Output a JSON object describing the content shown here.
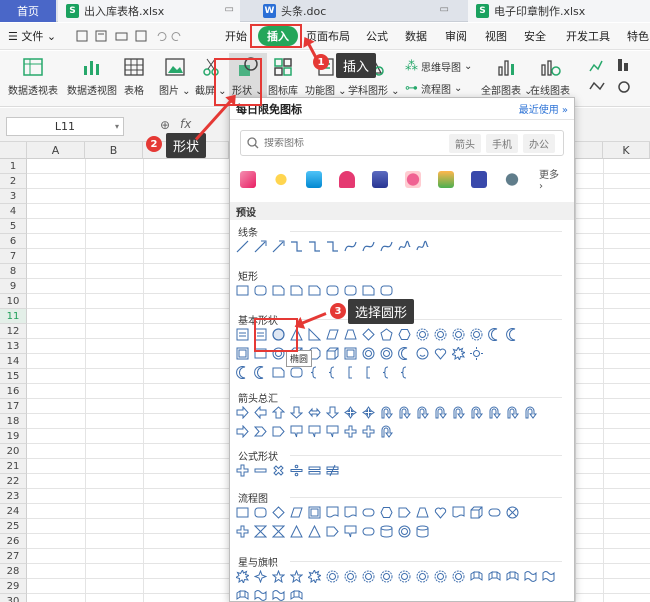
{
  "tabs": [
    {
      "label": "首页"
    },
    {
      "label": "出入库表格.xlsx",
      "kind": "S"
    },
    {
      "label": "头条.doc",
      "kind": "W"
    },
    {
      "label": "电子印章制作.xlsx",
      "kind": "S"
    }
  ],
  "menu": {
    "file": "文件",
    "items": [
      "开始",
      "插入",
      "页面布局",
      "公式",
      "数据",
      "审阅",
      "视图",
      "安全",
      "开发工具",
      "特色"
    ],
    "active": "插入"
  },
  "ribbon": {
    "buttons": [
      "数据透视表",
      "数据透视图",
      "表格",
      "图片",
      "截屏",
      "形状",
      "图标库",
      "功能图",
      "学科图形",
      "全部图表",
      "在线图表"
    ],
    "small": [
      "思维导图",
      "流程图"
    ],
    "shape_highlight": "形状"
  },
  "formula": {
    "cell_ref": "L11"
  },
  "grid": {
    "columns": [
      "A",
      "B",
      "K"
    ],
    "rows": [
      "1",
      "2",
      "3",
      "4",
      "5",
      "6",
      "7",
      "8",
      "9",
      "10",
      "11",
      "12",
      "13",
      "14",
      "15",
      "16",
      "17",
      "18",
      "19",
      "20",
      "21",
      "22",
      "23",
      "24",
      "25",
      "26",
      "27",
      "28",
      "29",
      "30"
    ],
    "selected_row": "11"
  },
  "panel": {
    "title": "每日限免图标",
    "recent": "最近使用",
    "search_placeholder": "搜索图标",
    "chips": [
      "箭头",
      "手机",
      "办公"
    ],
    "more": "更多",
    "preset": "预设",
    "sections": [
      "线条",
      "矩形",
      "基本形状",
      "箭头总汇",
      "公式形状",
      "流程图",
      "星与旗帜"
    ],
    "tooltip": "椭圆"
  },
  "callouts": [
    {
      "num": "1",
      "text": "插入"
    },
    {
      "num": "2",
      "text": "形状"
    },
    {
      "num": "3",
      "text": "选择圆形"
    }
  ],
  "colors": {
    "accent": "#24a65a",
    "callout": "#e53935",
    "icon_line": "#3f6fae"
  }
}
